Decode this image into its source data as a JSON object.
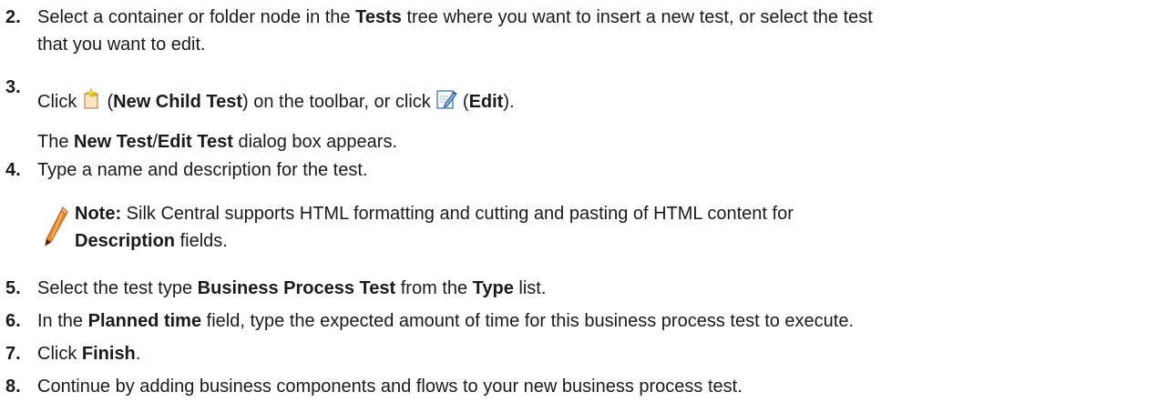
{
  "steps": {
    "s2": {
      "num": "2.",
      "t1": "Select a container or folder node in the ",
      "b1": "Tests",
      "t2": " tree where you want to insert a new test, or select the test",
      "t3": "that you want to edit."
    },
    "s3": {
      "num": "3.",
      "t1": "Click ",
      "t2": " (",
      "b1": "New Child Test",
      "t3": ") on the toolbar, or click ",
      "t4": " (",
      "b2": "Edit",
      "t5": ").",
      "sub_b1": "New Test",
      "sub_t1": "/",
      "sub_b2": "Edit Test",
      "sub_t2": " dialog box appears.",
      "sub_t0": "The "
    },
    "s4": {
      "num": "4.",
      "t1": "Type a name and description for the test."
    },
    "note": {
      "label": "Note:",
      "t1": " Silk Central supports HTML formatting and cutting and pasting of HTML content for",
      "b1": "Description",
      "t2": " fields.",
      "icon": "pencil-icon"
    },
    "s5": {
      "num": "5.",
      "t1": "Select the test type ",
      "b1": "Business Process Test",
      "t2": " from the ",
      "b2": "Type",
      "t3": " list."
    },
    "s6": {
      "num": "6.",
      "t1": "In the ",
      "b1": "Planned time",
      "t2": " field, type the expected amount of time for this business process test to execute."
    },
    "s7": {
      "num": "7.",
      "t1": "Click ",
      "b1": "Finish",
      "t2": "."
    },
    "s8": {
      "num": "8.",
      "t1": "Continue by adding business components and flows to your new business process test."
    }
  },
  "icons": {
    "new_child_test": "new-child-test-icon",
    "edit": "edit-icon"
  },
  "colors": {
    "text": "#1a1a1a",
    "pencil_orange": "#e8741c"
  }
}
